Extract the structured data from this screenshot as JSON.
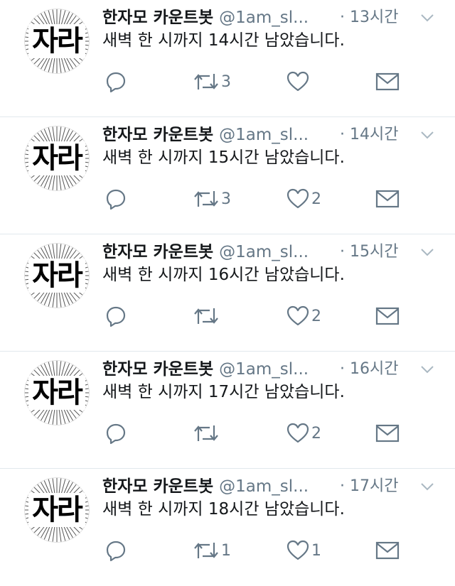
{
  "account": {
    "name": "한자모 카운트봇",
    "handle": "@1am_sl...",
    "avatar_text": "자라"
  },
  "tweets": [
    {
      "time": "· 13시간",
      "text": "새벽 한 시까지 14시간 남았습니다.",
      "retweets": "3",
      "likes": ""
    },
    {
      "time": "· 14시간",
      "text": "새벽 한 시까지 15시간 남았습니다.",
      "retweets": "3",
      "likes": "2"
    },
    {
      "time": "· 15시간",
      "text": "새벽 한 시까지 16시간 남았습니다.",
      "retweets": "",
      "likes": "2"
    },
    {
      "time": "· 16시간",
      "text": "새벽 한 시까지 17시간 남았습니다.",
      "retweets": "",
      "likes": "2"
    },
    {
      "time": "· 17시간",
      "text": "새벽 한 시까지 18시간 남았습니다.",
      "retweets": "1",
      "likes": "1"
    }
  ],
  "icons": {
    "reply": "reply-icon",
    "retweet": "retweet-icon",
    "like": "heart-icon",
    "dm": "envelope-icon",
    "more": "chevron-down-icon"
  },
  "colors": {
    "text": "#14171a",
    "secondary": "#657786",
    "divider": "#e1e8ed"
  }
}
